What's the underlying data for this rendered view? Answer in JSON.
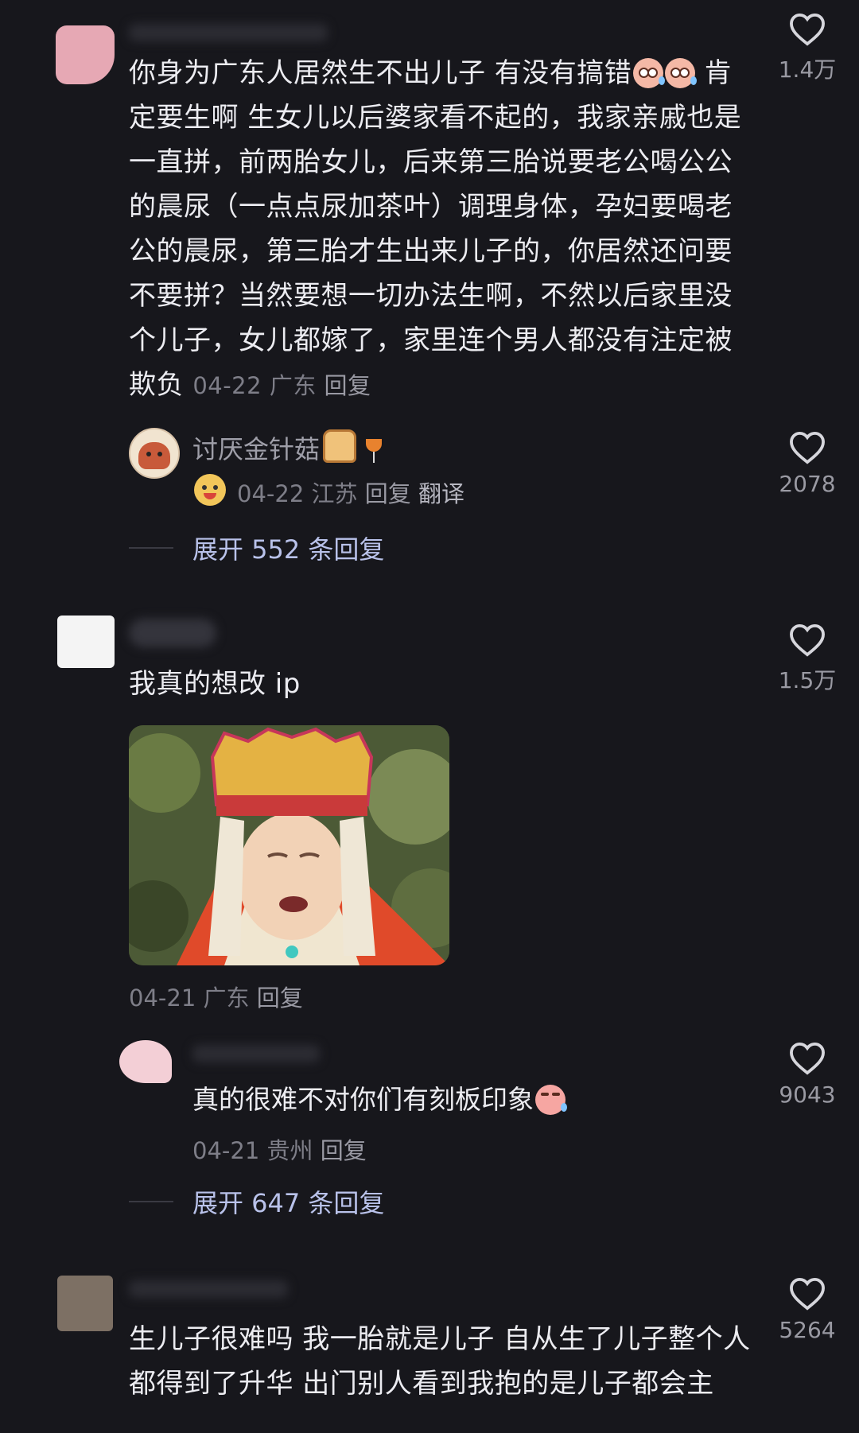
{
  "comments": [
    {
      "text": "你身为广东人居然生不出儿子 有没有搞错",
      "text_after_emoji": " 肯定要生啊 生女儿以后婆家看不起的，我家亲戚也是一直拼，前两胎女儿，后来第三胎说要老公喝公公的晨尿（一点点尿加茶叶）调理身体，孕妇要喝老公的晨尿，第三胎才生出来儿子的，你居然还问要不要拼？当然要想一切办法生啊，不然以后家里没个儿子，女儿都嫁了，家里连个男人都没有注定被欺负",
      "date": "04-22",
      "location": "广东",
      "reply_label": "回复",
      "likes": "1.4万"
    },
    {
      "username": "讨厌金针菇",
      "date": "04-22",
      "location": "江苏",
      "reply_label": "回复",
      "translate_label": "翻译",
      "likes": "2078"
    },
    {
      "expand_label": "展开 552 条回复"
    },
    {
      "text": "我真的想改 ip",
      "date": "04-21",
      "location": "广东",
      "reply_label": "回复",
      "likes": "1.5万"
    },
    {
      "text": "真的很难不对你们有刻板印象",
      "date": "04-21",
      "location": "贵州",
      "reply_label": "回复",
      "likes": "9043"
    },
    {
      "expand_label": "展开 647 条回复"
    },
    {
      "text": "生儿子很难吗 我一胎就是儿子 自从生了儿子整个人都得到了升华 出门别人看到我抱的是儿子都会主",
      "likes": "5264"
    }
  ],
  "colors": {
    "background": "#17171c",
    "text": "#ececf1",
    "meta": "#7e7e88",
    "expand": "#b9c2ea"
  },
  "icons": [
    "heart-outline-icon"
  ]
}
